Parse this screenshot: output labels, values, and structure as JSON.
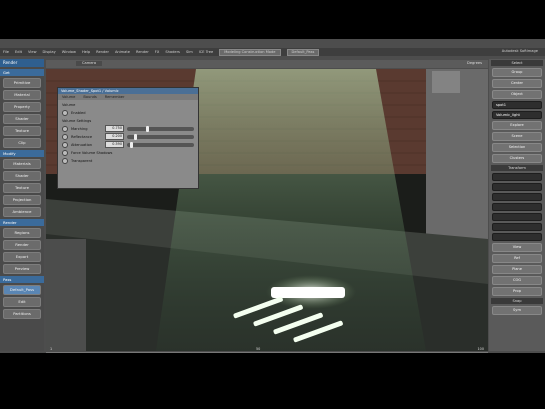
{
  "app": {
    "title": "Autodesk Softimage",
    "menus": [
      "File",
      "Edit",
      "View",
      "Display",
      "Window",
      "Help",
      "Render",
      "Animate",
      "Render",
      "FX",
      "Shaders",
      "Sim",
      "ICE Tree"
    ],
    "layout_combo": "Modeling Construction Mode",
    "pass_combo": "Default_Pass",
    "viewport_camera": "Camera",
    "viewport_scale": "Degrees"
  },
  "left_sidebar": {
    "header": "Render",
    "sections": [
      {
        "title": "Get",
        "buttons": [
          "Primitive",
          "Material",
          "Property",
          "Shader",
          "Texture",
          "Clip"
        ]
      },
      {
        "title": "Modify",
        "buttons": [
          "Materials",
          "Shader",
          "Texture",
          "Projection",
          "Ambience"
        ]
      },
      {
        "title": "Render",
        "buttons": [
          "Regions",
          "Render",
          "Export",
          "Preview"
        ]
      },
      {
        "title": "Pass",
        "buttons": [
          "Default_Pass",
          "Edit",
          "Partitions"
        ]
      }
    ]
  },
  "right_panel": {
    "select_label": "Select",
    "tool_buttons": [
      "Group",
      "Center",
      "Object"
    ],
    "object_name_field": "spot1",
    "object_name_field2": "Volumic_light",
    "explore_label": "Explore",
    "scene_label": "Scene",
    "selection_label": "Selection",
    "clusters_label": "Clusters",
    "transform_label": "Transform",
    "view_label": "View",
    "ref_label": "Ref",
    "plane_label": "Plane",
    "cog_label": "COG",
    "prop_label": "Prop",
    "snap_label": "Snap",
    "sym_label": "Sym"
  },
  "dialog": {
    "title": "Volume_Shader_Spot1 / Volumic",
    "tabs": [
      "Volume",
      "Bounds",
      "Remember"
    ],
    "section": "Volume",
    "enabled_label": "Enabled",
    "volume_settings_label": "Volume Settings",
    "rows": [
      {
        "label": "Marching",
        "value": "0.750",
        "fill": 0.28
      },
      {
        "label": "Reflectance",
        "value": "0.200",
        "fill": 0.1
      },
      {
        "label": "Attenuation",
        "value": "0.590",
        "fill": 0.05
      }
    ],
    "force_volume_label": "Force Volume Shadows",
    "transparent_label": "Transparent"
  },
  "timeline": {
    "values": [
      "1",
      "50",
      "100"
    ]
  }
}
